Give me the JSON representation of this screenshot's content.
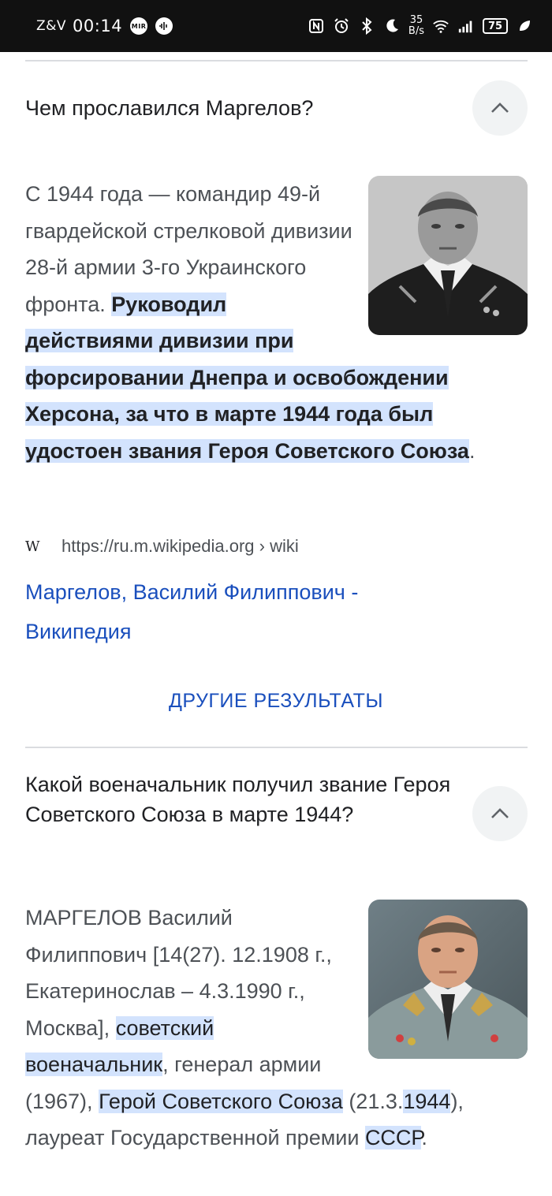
{
  "status_bar": {
    "carrier": "Z&V",
    "time": "00:14",
    "mir_label": "MIR",
    "speed_value": "35",
    "speed_unit": "B/s",
    "battery": "75"
  },
  "faq1": {
    "question": "Чем прославился Маргелов?",
    "answer_plain": "С 1944 года — командир 49-й гвардейской стрелковой дивизии 28-й армии 3-го Украинского фронта. ",
    "answer_highlight": "Руководил действиями дивизии при форсировании Днепра и освобождении Херсона, за что в марте 1944 года был удостоен звания Героя Советского Союза",
    "answer_end": ".",
    "source_url": "https://ru.m.wikipedia.org › wiki",
    "source_logo": "W",
    "link_title": "Маргелов, Василий Филиппович - Википедия"
  },
  "more_results_label": "ДРУГИЕ РЕЗУЛЬТАТЫ",
  "faq2": {
    "question": "Какой военачальник получил звание Героя Советского Союза в марте 1944?",
    "seg1": "МАРГЕЛОВ Василий Филиппович [14(27). 12.1908 г., Екатеринослав – 4.3.1990 г., Москва], ",
    "hl1": "советский военачальник",
    "seg2": ", генерал армии (1967), ",
    "hl2": "Герой Советского Союза",
    "seg3": " (21.3.",
    "hl3": "1944",
    "seg4": "), лауреат Государственной премии ",
    "hl4": "СССР",
    "seg5": "."
  },
  "colors": {
    "link": "#1a4fbd",
    "highlight": "#d3e3fd",
    "text": "#4d5156"
  }
}
